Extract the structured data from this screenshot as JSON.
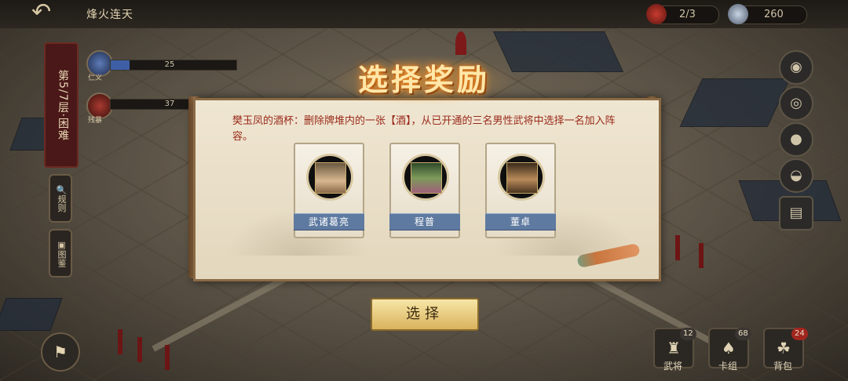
{
  "header": {
    "level_title": "烽火连天",
    "draw_count": "2/3",
    "coins": "260"
  },
  "left_panel": {
    "floor_label": "第5/7层·困难",
    "stats": [
      {
        "label": "仁义",
        "value": "25",
        "fraction": 0.15
      },
      {
        "label": "残暴",
        "value": "37",
        "fraction": 0.0
      }
    ],
    "rules_label": "规则",
    "atlas_label": "图鉴"
  },
  "modal": {
    "title": "选择奖励",
    "description": "樊玉凤的酒杯：删除牌堆内的一张【酒】，从已开通的三名男性武将中选择一名加入阵容。",
    "choices": [
      {
        "name": "武诸葛亮"
      },
      {
        "name": "程普"
      },
      {
        "name": "董卓"
      }
    ],
    "select_label": "选择"
  },
  "bottom_nav": [
    {
      "label": "武将",
      "badge": "12"
    },
    {
      "label": "卡组",
      "badge": "68"
    },
    {
      "label": "背包",
      "badge": "24"
    }
  ],
  "colors": {
    "accent_gold": "#d9b25d",
    "name_plate": "#5f7aa0",
    "description_red": "#9a2a1a",
    "badge_red": "#a1261f"
  }
}
